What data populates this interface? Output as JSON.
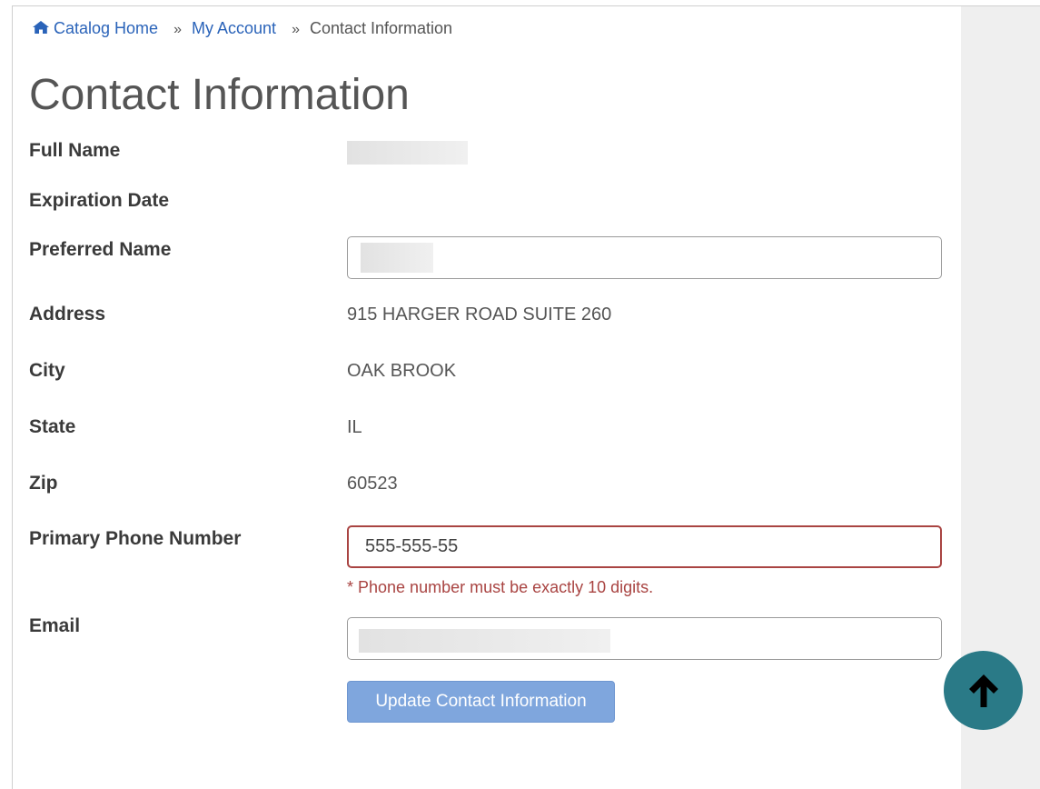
{
  "breadcrumb": {
    "items": [
      {
        "label": "Catalog Home",
        "icon": "home-icon"
      },
      {
        "label": "My Account"
      }
    ],
    "current": "Contact Information",
    "separator": "»"
  },
  "page": {
    "title": "Contact Information"
  },
  "form": {
    "full_name": {
      "label": "Full Name"
    },
    "expiration_date": {
      "label": "Expiration Date"
    },
    "preferred_name": {
      "label": "Preferred Name",
      "value": ""
    },
    "address": {
      "label": "Address",
      "value": "915 HARGER ROAD SUITE 260"
    },
    "city": {
      "label": "City",
      "value": "OAK BROOK"
    },
    "state": {
      "label": "State",
      "value": "IL"
    },
    "zip": {
      "label": "Zip",
      "value": "60523"
    },
    "primary_phone": {
      "label": "Primary Phone Number",
      "value": "555-555-55",
      "error": "* Phone number must be exactly 10 digits."
    },
    "email": {
      "label": "Email",
      "value": ""
    },
    "submit_label": "Update Contact Information"
  },
  "colors": {
    "link": "#2a63b9",
    "error": "#a94442",
    "button": "#7fa6dd",
    "scroll_top": "#2a7a87"
  },
  "scroll_top": {
    "icon": "arrow-up-icon"
  }
}
